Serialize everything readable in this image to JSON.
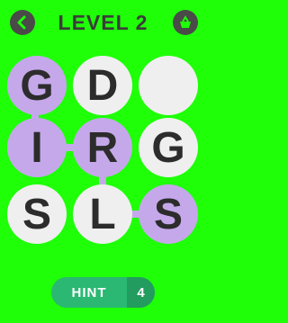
{
  "header": {
    "level_title": "LEVEL 2",
    "back_icon": "chevron-left-icon",
    "shop_icon": "basket-icon"
  },
  "board": {
    "rows": [
      [
        {
          "letter": "G",
          "state": "used"
        },
        {
          "letter": "D",
          "state": "free"
        },
        {
          "letter": "",
          "state": "free"
        }
      ],
      [
        {
          "letter": "I",
          "state": "used"
        },
        {
          "letter": "R",
          "state": "used"
        },
        {
          "letter": "G",
          "state": "free"
        }
      ],
      [
        {
          "letter": "S",
          "state": "free"
        },
        {
          "letter": "L",
          "state": "free"
        },
        {
          "letter": "S",
          "state": "used"
        }
      ]
    ]
  },
  "hint": {
    "label": "HINT",
    "count": "4"
  },
  "colors": {
    "background": "#1eff08",
    "tile_used": "#c5a8ea",
    "tile_free": "#efefef",
    "hint": "#2ab873"
  }
}
